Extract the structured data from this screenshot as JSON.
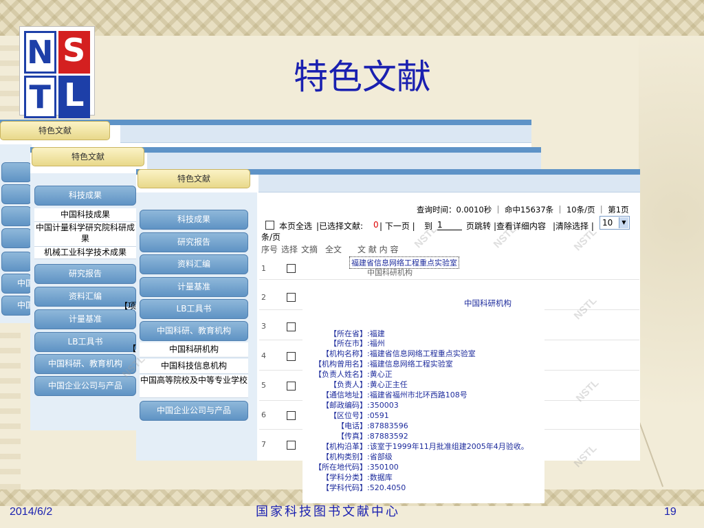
{
  "slide": {
    "title": "特色文献",
    "logo_letters": [
      "N",
      "S",
      "T",
      "L"
    ],
    "footer_date": "2014/6/2",
    "footer_org": "国家科技图书文献中心",
    "page_number": "19"
  },
  "panel1": {
    "tab": "特色文献",
    "side_cut": [
      "中国",
      "中国"
    ]
  },
  "panel2": {
    "tab": "特色文献",
    "buttons": [
      "科技成果",
      "研究报告",
      "资料汇编",
      "计量基准",
      "LB工具书",
      "中国科研、教育机构",
      "中国企业公司与产品"
    ],
    "links": [
      "中国科技成果",
      "中国计量科学研究院科研成果",
      "机械工业科学技术成果"
    ],
    "hidden_fragments": [
      "【项",
      "【"
    ]
  },
  "panel3": {
    "tab": "特色文献",
    "buttons": [
      "科技成果",
      "研究报告",
      "资料汇编",
      "计量基准",
      "LB工具书",
      "中国科研、教育机构",
      "中国企业公司与产品"
    ],
    "links": [
      "中国科研机构",
      "中国科技信息机构",
      "中国高等院校及中等专业学校"
    ],
    "query_info": "查询时间：0.0010秒 ｜ 命中15637条 ｜ 10条/页 ｜ 第1页",
    "toolbar": {
      "select_all": "本页全选",
      "selected": "|已选择文献:",
      "selected_count": "0",
      "next_page": "| 下一页 |",
      "goto": "到",
      "page_input": "1",
      "page_jump": "页跳转",
      "view_detail": "|查看详细内容",
      "clear": "|清除选择 |",
      "per_page": "10",
      "per_page_unit": "条/页"
    },
    "table_headers": [
      "序号",
      "选择",
      "文摘",
      "全文",
      "文 献 内 容"
    ],
    "rows": [
      {
        "num": "1",
        "title": "福建省信息网络工程重点实验室",
        "sub": "中国科研机构"
      },
      {
        "num": "2",
        "title": "",
        "sub": ""
      },
      {
        "num": "3",
        "title": "",
        "sub": ""
      },
      {
        "num": "4",
        "title": "",
        "sub": ""
      },
      {
        "num": "5",
        "title": "",
        "sub": ""
      },
      {
        "num": "6",
        "title": "",
        "sub": ""
      },
      {
        "num": "7",
        "title": "",
        "sub": ""
      }
    ]
  },
  "detail": {
    "heading": "中国科研机构",
    "fields": [
      {
        "key": "【所在省】",
        "value": ":福建"
      },
      {
        "key": "【所在市】",
        "value": ":福州"
      },
      {
        "key": "【机构名称】",
        "value": ":福建省信息网络工程重点实验室"
      },
      {
        "key": "【机构曾用名】",
        "value": ":福建信息网络工程实验室"
      },
      {
        "key": "【负责人姓名】",
        "value": ":黄心正"
      },
      {
        "key": "【负责人】",
        "value": ":黄心正主任"
      },
      {
        "key": "【通信地址】",
        "value": ":福建省福州市北环西路108号"
      },
      {
        "key": "【邮政编码】",
        "value": ":350003"
      },
      {
        "key": "【区位号】",
        "value": ":0591"
      },
      {
        "key": "【电话】",
        "value": ":87883596"
      },
      {
        "key": "【传真】",
        "value": ":87883592"
      },
      {
        "key": "【机构沿革】",
        "value": ":该室于1999年11月批准组建2005年4月验收。"
      },
      {
        "key": "【机构类别】",
        "value": ":省部级"
      },
      {
        "key": "【所在地代码】",
        "value": ":350100"
      },
      {
        "key": "【学科分类】",
        "value": ":数据库"
      },
      {
        "key": "【学科代码】",
        "value": ":520.4050"
      }
    ]
  },
  "watermark_text": "NSTL",
  "colors": {
    "title_blue": "#1a20b0",
    "tab_gold": "#e8d88a",
    "side_blue": "#5f93c4"
  }
}
